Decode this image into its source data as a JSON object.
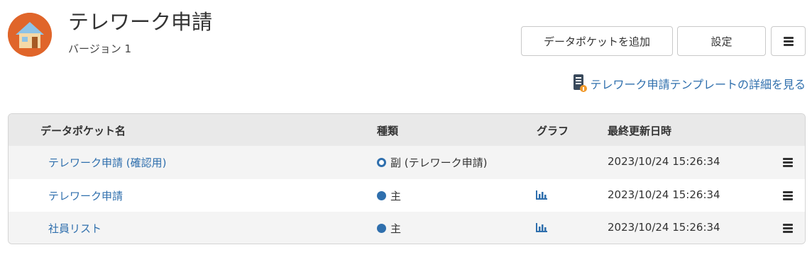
{
  "header": {
    "title": "テレワーク申請",
    "version": "バージョン 1",
    "app_icon": "house-icon",
    "accent_color": "#e0652a"
  },
  "toolbar": {
    "add_pocket_label": "データポケットを追加",
    "settings_label": "設定",
    "menu_icon": "hamburger-menu-icon"
  },
  "template_link": {
    "label": "テレワーク申請テンプレートの詳細を見る",
    "icon": "template-document-icon"
  },
  "table": {
    "columns": {
      "name": "データポケット名",
      "kind": "種類",
      "graph": "グラフ",
      "updated": "最終更新日時"
    },
    "rows": [
      {
        "name": "テレワーク申請 (確認用)",
        "kind": "副 (テレワーク申請)",
        "kind_icon": "hollow",
        "has_graph": false,
        "updated": "2023/10/24 15:26:34"
      },
      {
        "name": "テレワーク申請",
        "kind": "主",
        "kind_icon": "filled",
        "has_graph": true,
        "updated": "2023/10/24 15:26:34"
      },
      {
        "name": "社員リスト",
        "kind": "主",
        "kind_icon": "filled",
        "has_graph": true,
        "updated": "2023/10/24 15:26:34"
      }
    ]
  },
  "colors": {
    "link": "#2f6fad",
    "header_bg": "#e9e9e9",
    "alt_row_bg": "#f4f4f4"
  }
}
